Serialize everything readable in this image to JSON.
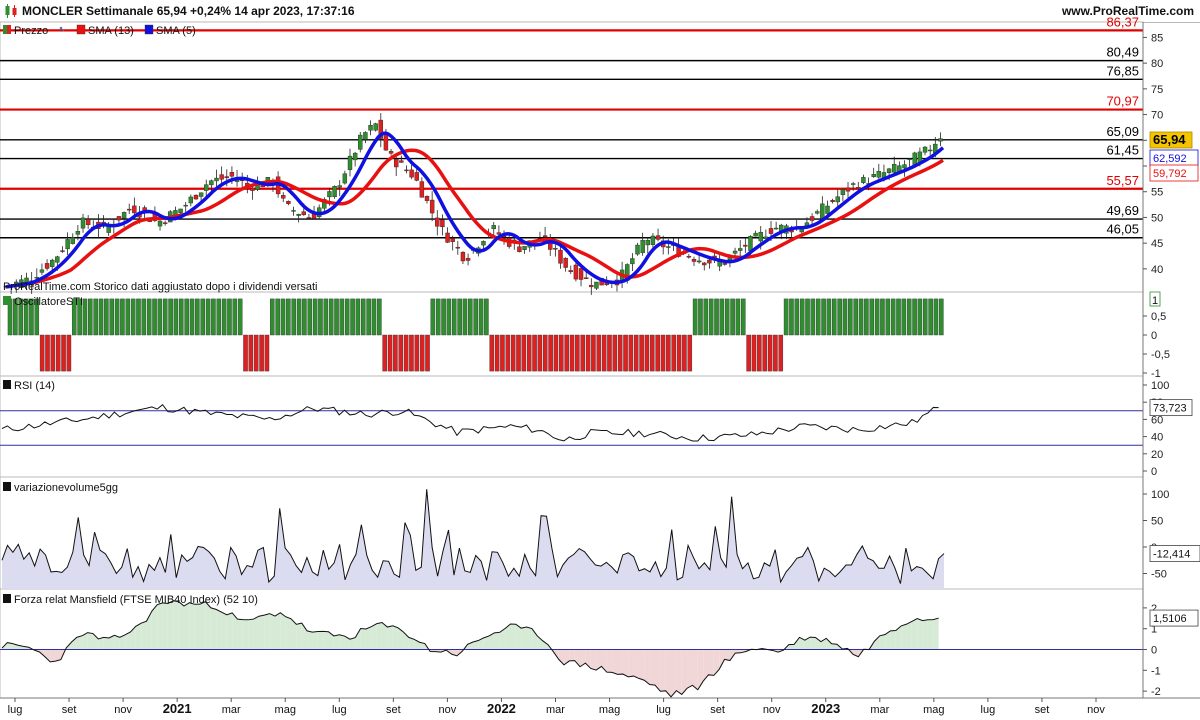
{
  "header": {
    "title": "MONCLER Settimanale 65,94 +0,24% 14 apr 2023, 17:37:16",
    "brand": "www.ProRealTime.com"
  },
  "colors": {
    "up": "#2f8f2f",
    "down": "#e02020",
    "sma13": "#e81010",
    "sma5": "#1010e0",
    "level_black": "#000000",
    "level_red": "#e00000",
    "area_fill": "#dcdcf0",
    "area_pos": "#d6ead6",
    "area_neg": "#f0d6d6",
    "refline": "#3030a0"
  },
  "x_axis": {
    "labels": [
      "lug",
      "set",
      "nov",
      "2021",
      "mar",
      "mag",
      "lug",
      "set",
      "nov",
      "2022",
      "mar",
      "mag",
      "lug",
      "set",
      "nov",
      "2023",
      "mar",
      "mag",
      "lug",
      "set",
      "nov"
    ],
    "bold": [
      "2021",
      "2022",
      "2023"
    ]
  },
  "chart_data": [
    {
      "panel": "price",
      "type": "candlestick",
      "title": "Prezzo",
      "legend": [
        "Prezzo",
        "SMA (13)",
        "SMA (5)"
      ],
      "note": "ProRealTime.com  Storico dati aggiustato dopo i dividendi versati",
      "y_ticks": [
        40,
        45,
        50,
        55,
        60,
        65,
        70,
        75,
        80,
        85
      ],
      "ylim": [
        35.5,
        88
      ],
      "levels": [
        {
          "value": 86.37,
          "label": "86,37",
          "color": "red"
        },
        {
          "value": 80.49,
          "label": "80,49",
          "color": "black"
        },
        {
          "value": 76.85,
          "label": "76,85",
          "color": "black"
        },
        {
          "value": 70.97,
          "label": "70,97",
          "color": "red"
        },
        {
          "value": 65.09,
          "label": "65,09",
          "color": "black"
        },
        {
          "value": 61.45,
          "label": "61,45",
          "color": "black"
        },
        {
          "value": 55.57,
          "label": "55,57",
          "color": "red"
        },
        {
          "value": 49.69,
          "label": "49,69",
          "color": "black"
        },
        {
          "value": 46.05,
          "label": "46,05",
          "color": "black"
        }
      ],
      "last_price": "65,94",
      "sma5_last": "62,592",
      "sma13_last": "59,792",
      "close_keypoints": [
        [
          0,
          36.5
        ],
        [
          10,
          38
        ],
        [
          20,
          42
        ],
        [
          30,
          49
        ],
        [
          40,
          48
        ],
        [
          50,
          52
        ],
        [
          60,
          49
        ],
        [
          70,
          52
        ],
        [
          80,
          57
        ],
        [
          90,
          58
        ],
        [
          95,
          56
        ],
        [
          105,
          57
        ],
        [
          110,
          52
        ],
        [
          120,
          50
        ],
        [
          130,
          56
        ],
        [
          140,
          66
        ],
        [
          145,
          68
        ],
        [
          150,
          62
        ],
        [
          160,
          58
        ],
        [
          170,
          48
        ],
        [
          180,
          42
        ],
        [
          190,
          48
        ],
        [
          200,
          44
        ],
        [
          210,
          46
        ],
        [
          220,
          40
        ],
        [
          230,
          37
        ],
        [
          240,
          38
        ],
        [
          250,
          46
        ],
        [
          260,
          44
        ],
        [
          270,
          42
        ],
        [
          280,
          41
        ],
        [
          290,
          45
        ],
        [
          300,
          48
        ],
        [
          310,
          48
        ],
        [
          320,
          52
        ],
        [
          330,
          56
        ],
        [
          340,
          58
        ],
        [
          350,
          60
        ],
        [
          360,
          63
        ],
        [
          365,
          65.9
        ]
      ]
    },
    {
      "panel": "sti",
      "type": "bar",
      "title": "OscillatoreSTI",
      "y_ticks": [
        "1",
        "0,5",
        "0",
        "-0,5",
        "-1"
      ],
      "last_value": "1",
      "segments": [
        [
          1,
          6,
          1
        ],
        [
          7,
          12,
          -1
        ],
        [
          13,
          44,
          1
        ],
        [
          45,
          49,
          -1
        ],
        [
          50,
          70,
          1
        ],
        [
          71,
          79,
          -1
        ],
        [
          80,
          90,
          1
        ],
        [
          91,
          128,
          -1
        ],
        [
          129,
          138,
          1
        ],
        [
          139,
          145,
          -1
        ],
        [
          146,
          175,
          1
        ]
      ]
    },
    {
      "panel": "rsi",
      "type": "line",
      "title": "RSI (14)",
      "y_ticks": [
        100,
        80,
        60,
        40,
        20,
        0
      ],
      "ylim": [
        0,
        100
      ],
      "bands": [
        70,
        30
      ],
      "last_value": "73,723",
      "keypoints": [
        [
          0,
          48
        ],
        [
          15,
          60
        ],
        [
          25,
          70
        ],
        [
          30,
          74
        ],
        [
          40,
          66
        ],
        [
          50,
          60
        ],
        [
          58,
          73
        ],
        [
          68,
          66
        ],
        [
          75,
          70
        ],
        [
          85,
          45
        ],
        [
          95,
          52
        ],
        [
          100,
          48
        ],
        [
          105,
          36
        ],
        [
          110,
          44
        ],
        [
          120,
          44
        ],
        [
          130,
          38
        ],
        [
          140,
          42
        ],
        [
          150,
          52
        ],
        [
          160,
          48
        ],
        [
          170,
          56
        ],
        [
          175,
          73.7
        ]
      ]
    },
    {
      "panel": "volume",
      "type": "area",
      "title": "variazionevolume5gg",
      "y_ticks": [
        100,
        50,
        0,
        -50
      ],
      "ylim": [
        -75,
        120
      ],
      "last_value": "-12,414",
      "values": [
        -25,
        3,
        -10,
        5,
        -23,
        -11,
        -36,
        -4,
        -15,
        -47,
        -46,
        -48,
        -38,
        -10,
        56,
        -15,
        -35,
        28,
        -6,
        -13,
        -30,
        -50,
        -38,
        -3,
        -57,
        -37,
        -65,
        -33,
        -44,
        -20,
        -48,
        24,
        -58,
        -15,
        -27,
        -20,
        1,
        -1,
        -9,
        -21,
        -46,
        -60,
        -1,
        -17,
        -52,
        -35,
        -38,
        -6,
        -1,
        -66,
        -55,
        73,
        -2,
        -15,
        -35,
        -48,
        -20,
        -47,
        -54,
        -6,
        -42,
        -30,
        5,
        -62,
        -33,
        -14,
        42,
        -16,
        -44,
        -57,
        -26,
        -27,
        -51,
        -57,
        46,
        22,
        -44,
        -38,
        109,
        -1,
        -55,
        -7,
        32,
        -53,
        -2,
        -45,
        -48,
        -16,
        -27,
        -63,
        -9,
        -10,
        -30,
        -55,
        -40,
        -55,
        -14,
        -40,
        -54,
        59,
        58,
        -3,
        -56,
        -34,
        -21,
        -14,
        -3,
        -9,
        -22,
        -34,
        -36,
        -29,
        -38,
        -49,
        -15,
        -11,
        -18,
        -45,
        -41,
        -47,
        -28,
        -56,
        -40,
        33,
        -62,
        -57,
        3,
        -20,
        -41,
        -30,
        -43,
        39,
        -21,
        -38,
        95,
        -14,
        -41,
        -30,
        -60,
        -57,
        -30,
        -36,
        -5,
        -66,
        -47,
        -35,
        -21,
        -18,
        -1,
        -26,
        -64,
        -40,
        -46,
        -56,
        -46,
        -34,
        -34,
        -14,
        2,
        -21,
        -26,
        -40,
        -40,
        -17,
        -40,
        -69,
        -2,
        -45,
        -37,
        -40,
        -50,
        -60,
        -22,
        -12.4
      ]
    },
    {
      "panel": "mansfield",
      "type": "area",
      "title": "Forza relat Mansfield (FTSE MIB40 Index) (52 10)",
      "y_ticks": [
        2,
        1,
        0,
        -1,
        -2
      ],
      "ylim": [
        -2.4,
        2.3
      ],
      "last_value": "1,5106",
      "keypoints": [
        [
          0,
          0.2
        ],
        [
          5,
          0.1
        ],
        [
          10,
          -0.6
        ],
        [
          15,
          0.8
        ],
        [
          20,
          0.4
        ],
        [
          25,
          1.0
        ],
        [
          30,
          2.3
        ],
        [
          40,
          2.1
        ],
        [
          45,
          1.3
        ],
        [
          52,
          1.8
        ],
        [
          58,
          0.8
        ],
        [
          65,
          0.6
        ],
        [
          70,
          1.2
        ],
        [
          75,
          0.9
        ],
        [
          80,
          0.0
        ],
        [
          85,
          -0.2
        ],
        [
          90,
          0.6
        ],
        [
          95,
          1.1
        ],
        [
          100,
          0.8
        ],
        [
          105,
          -0.6
        ],
        [
          110,
          -0.8
        ],
        [
          120,
          -1.5
        ],
        [
          125,
          -2.2
        ],
        [
          130,
          -1.8
        ],
        [
          135,
          -0.6
        ],
        [
          140,
          0.1
        ],
        [
          145,
          -0.1
        ],
        [
          150,
          0.6
        ],
        [
          155,
          0.4
        ],
        [
          160,
          -0.3
        ],
        [
          165,
          0.8
        ],
        [
          170,
          1.5
        ],
        [
          175,
          1.5106
        ]
      ]
    }
  ]
}
